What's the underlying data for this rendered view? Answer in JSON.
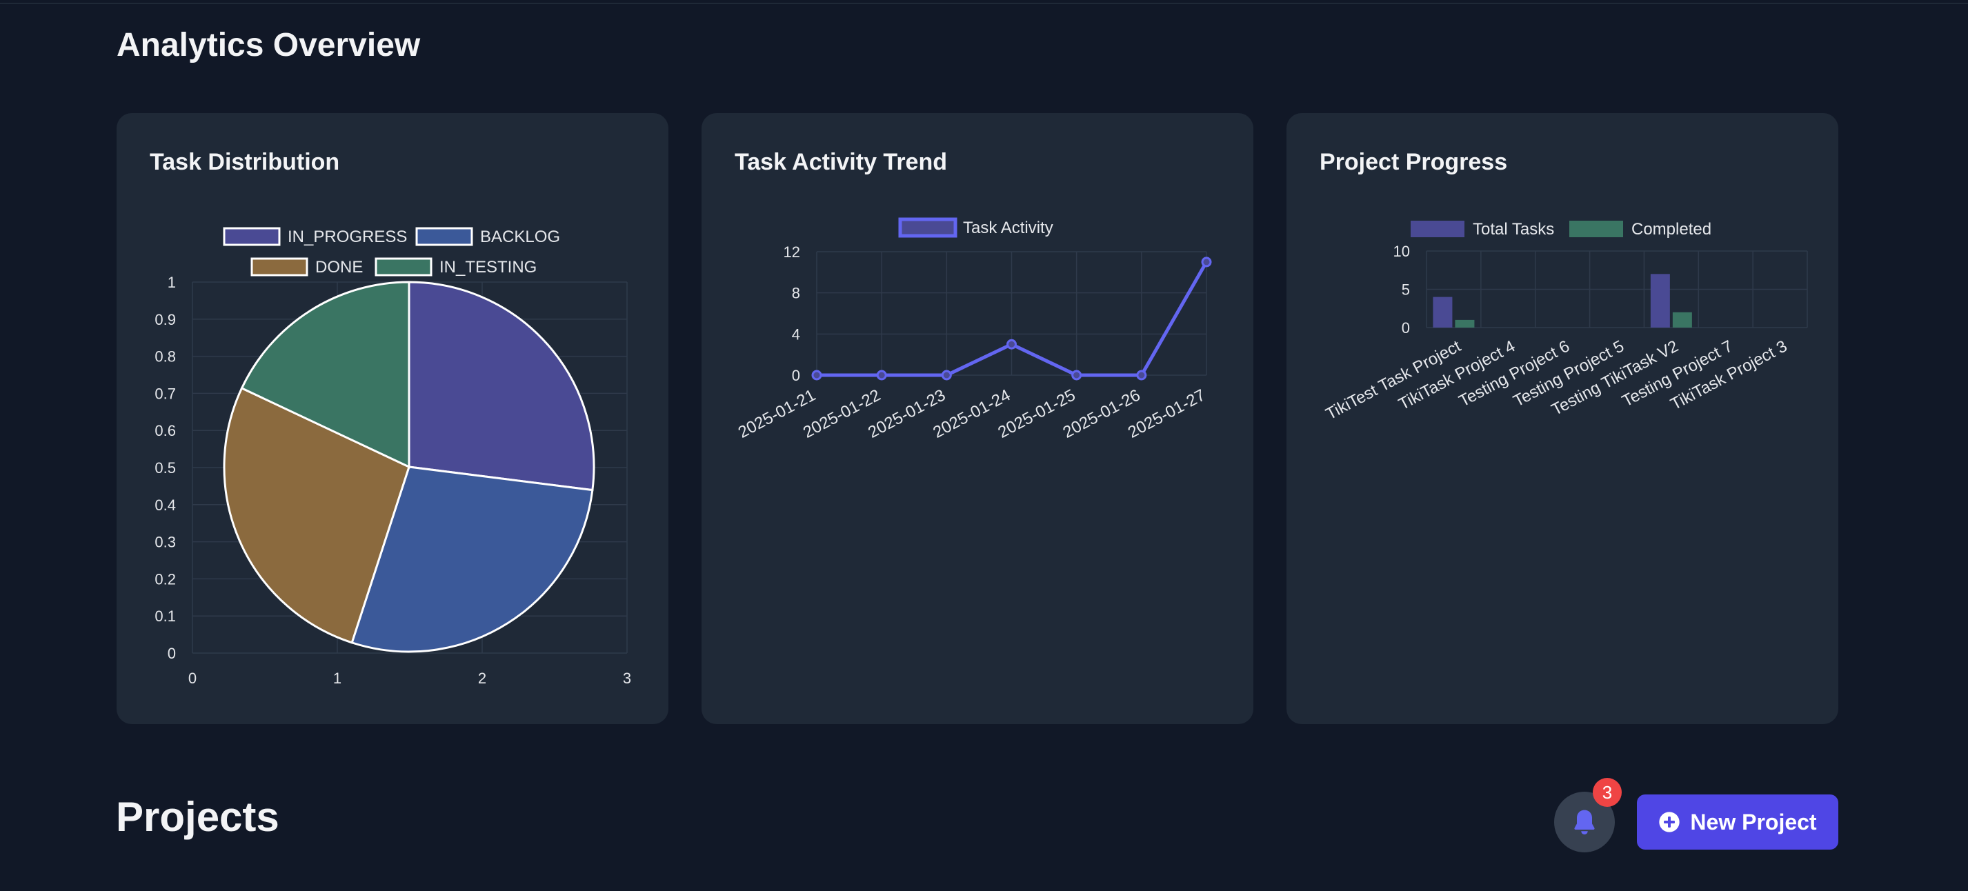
{
  "header": {
    "title": "Analytics Overview"
  },
  "projects": {
    "title": "Projects",
    "new_project_label": "New Project",
    "notification_count": "3"
  },
  "colors": {
    "indigo": "#6366f1",
    "indigo_fill": "#4a4a94",
    "blue_fill": "#3b5999",
    "brown_fill": "#8b6a3e",
    "green_fill": "#3a7563",
    "grid": "#2f3a4b",
    "axis_text": "#e5e7eb"
  },
  "chart_data": [
    {
      "type": "pie",
      "title": "Task Distribution",
      "categories": [
        "IN_PROGRESS",
        "BACKLOG",
        "DONE",
        "IN_TESTING"
      ],
      "values": [
        27,
        28,
        27,
        18
      ],
      "colors": [
        "#4a4a94",
        "#3b5999",
        "#8b6a3e",
        "#3a7563"
      ],
      "xlim": [
        0,
        3
      ],
      "ylim": [
        0,
        1
      ],
      "x_ticks": [
        "0",
        "1",
        "2",
        "3"
      ],
      "y_ticks": [
        "0",
        "0.1",
        "0.2",
        "0.3",
        "0.4",
        "0.5",
        "0.6",
        "0.7",
        "0.8",
        "0.9",
        "1"
      ],
      "grid": true,
      "legend": "top"
    },
    {
      "type": "line",
      "title": "Task Activity Trend",
      "categories": [
        "2025-01-21",
        "2025-01-22",
        "2025-01-23",
        "2025-01-24",
        "2025-01-25",
        "2025-01-26",
        "2025-01-27"
      ],
      "series": [
        {
          "name": "Task Activity",
          "values": [
            0,
            0,
            0,
            3,
            0,
            0,
            11
          ]
        }
      ],
      "ylim": [
        0,
        12
      ],
      "y_ticks": [
        "0",
        "4",
        "8",
        "12"
      ],
      "grid": true,
      "legend": "top"
    },
    {
      "type": "bar",
      "title": "Project Progress",
      "categories": [
        "TikiTest Task Project",
        "TikiTask Project 4",
        "Testing Project 6",
        "Testing Project 5",
        "Testing TikiTask V2",
        "Testing Project 7",
        "TikiTask Project 3"
      ],
      "series": [
        {
          "name": "Total Tasks",
          "values": [
            4,
            0,
            0,
            0,
            7,
            0,
            0
          ],
          "color": "#4a4a94"
        },
        {
          "name": "Completed",
          "values": [
            1,
            0,
            0,
            0,
            2,
            0,
            0
          ],
          "color": "#3a7563"
        }
      ],
      "ylim": [
        0,
        10
      ],
      "y_ticks": [
        "0",
        "5",
        "10"
      ],
      "grid": true,
      "legend": "top"
    }
  ]
}
